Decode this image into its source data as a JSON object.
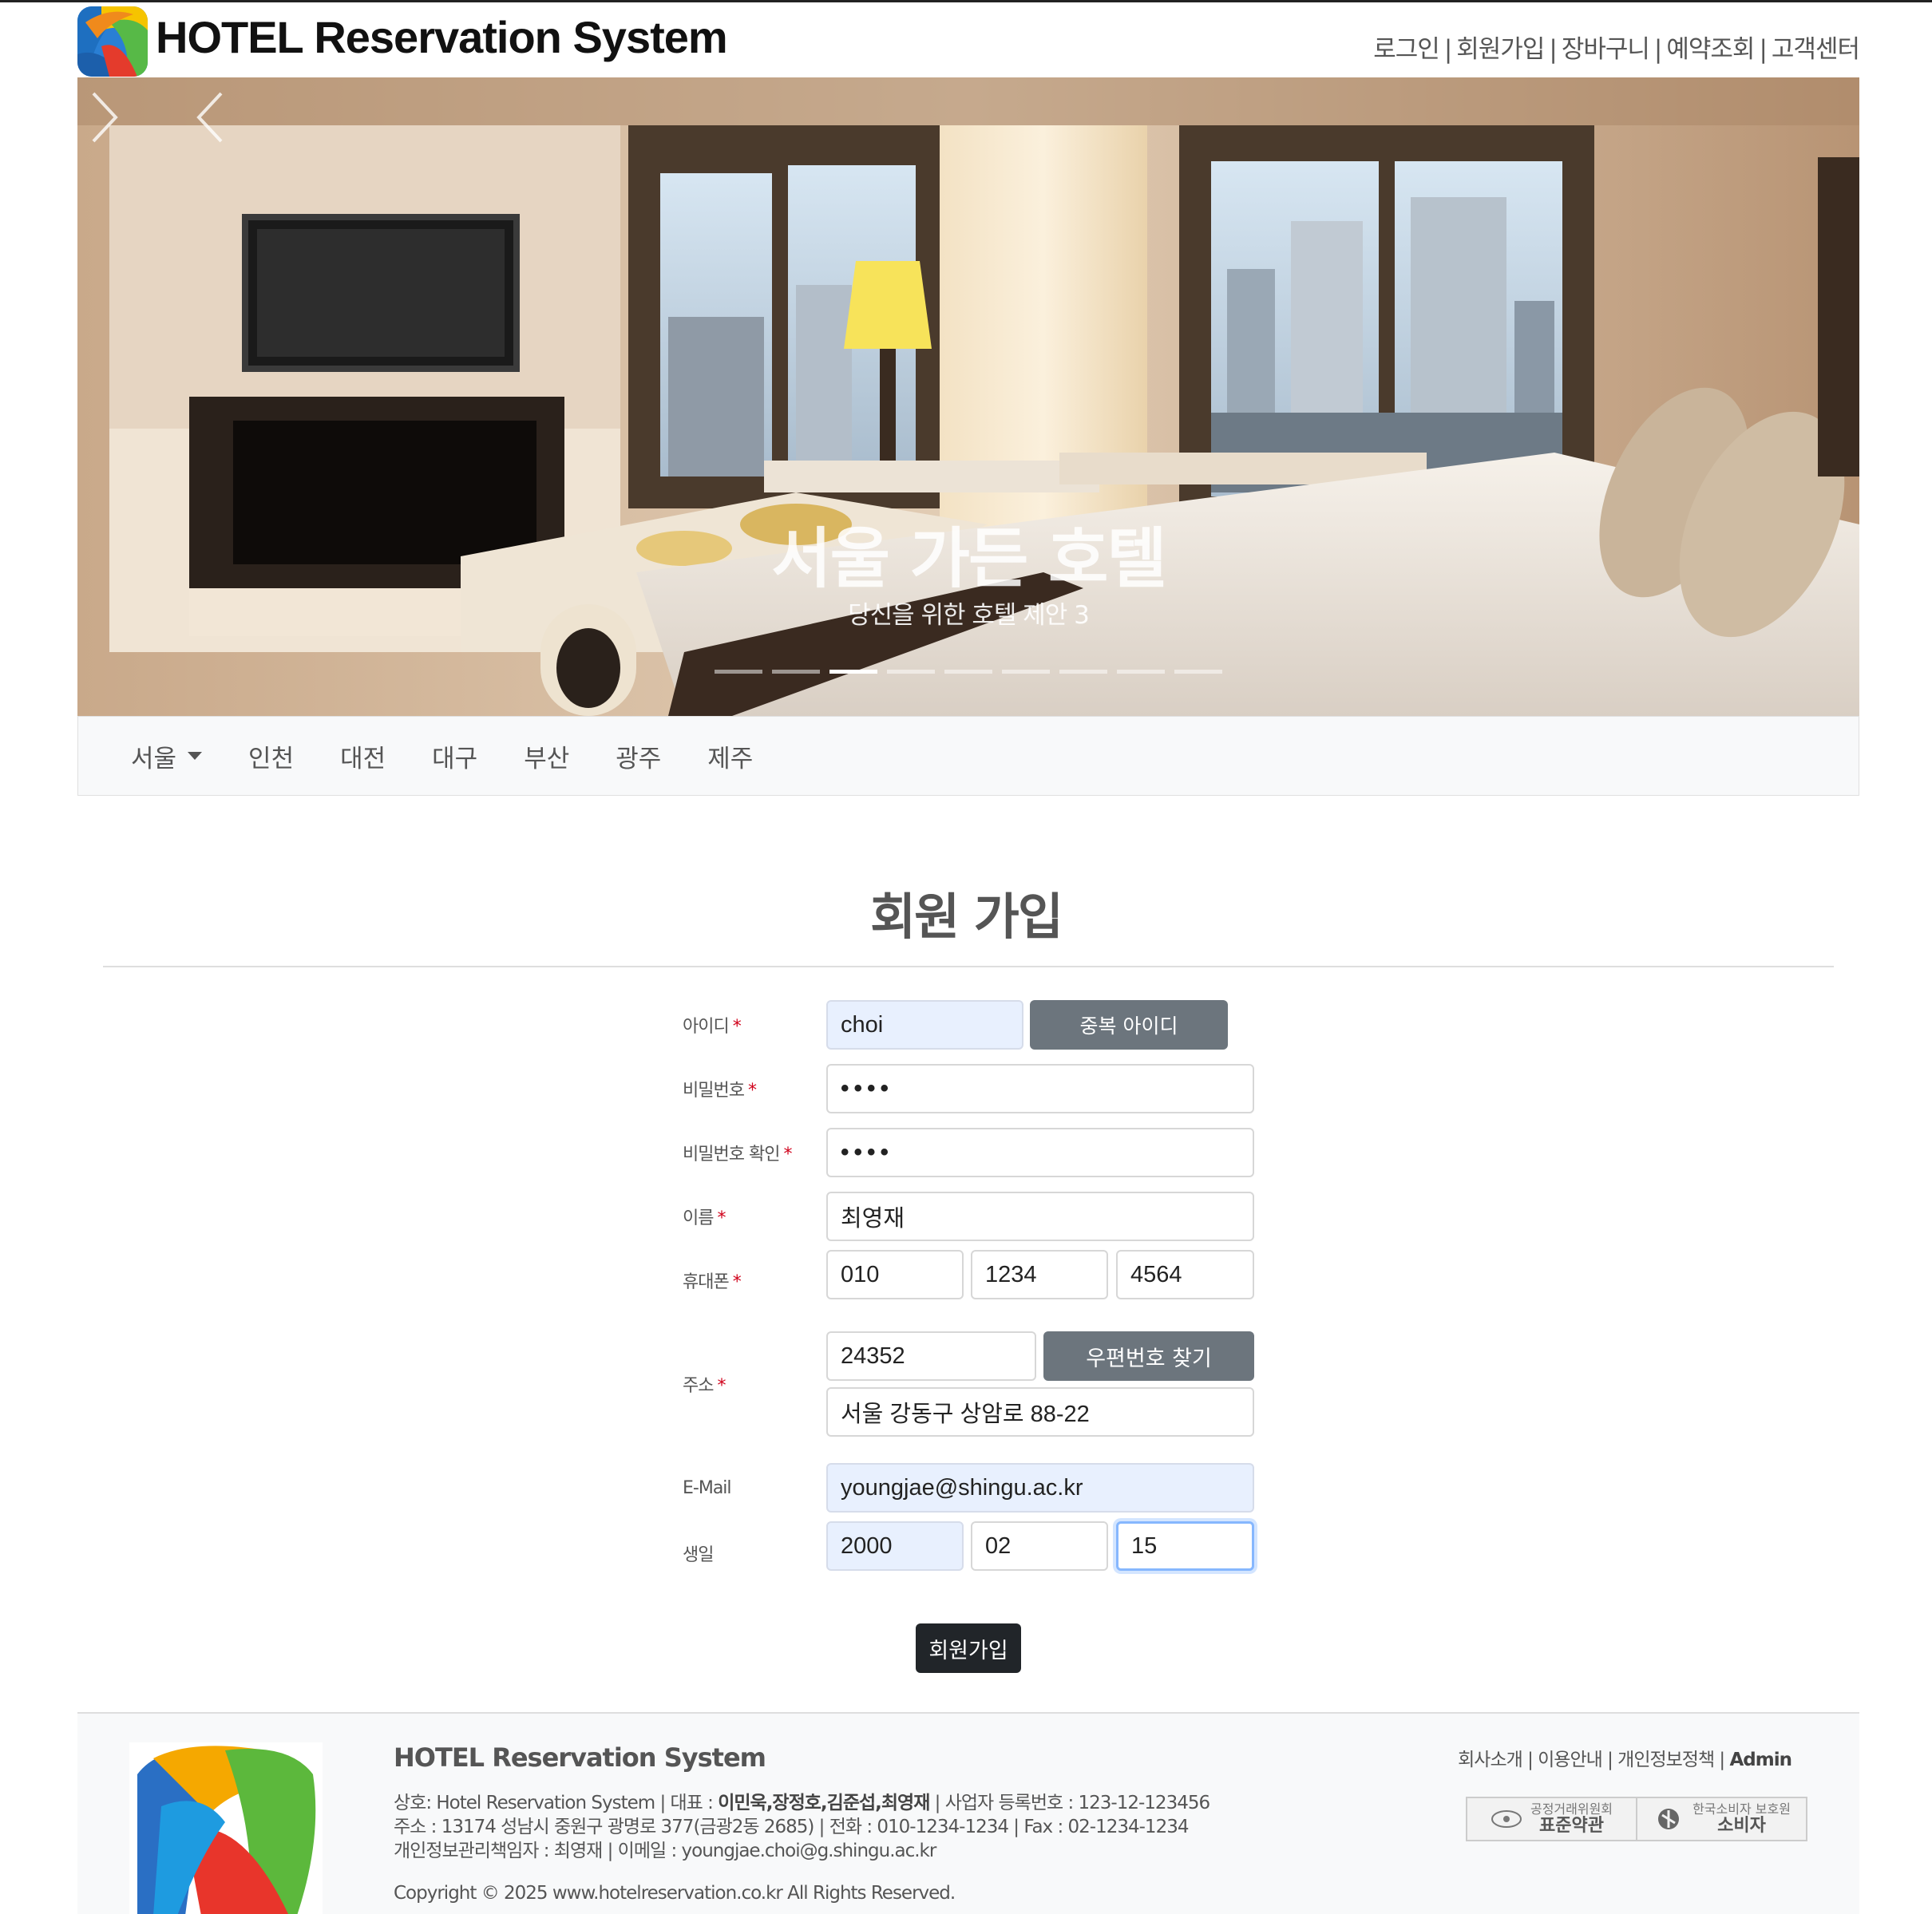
{
  "header": {
    "brand": "HOTEL Reservation System",
    "nav": [
      "로그인",
      "회원가입",
      "장바구니",
      "예약조회",
      "고객센터"
    ],
    "separator": "|"
  },
  "hero": {
    "title": "서울 가든 호텔",
    "subtitle": "당신을 위한 호텔 제안 3",
    "slide_count": 9,
    "active_slide": 3
  },
  "cities": [
    "서울",
    "인천",
    "대전",
    "대구",
    "부산",
    "광주",
    "제주"
  ],
  "page_title": "회원 가입",
  "form": {
    "id_label": "아이디",
    "id_value": "choi",
    "dup_button": "중복 아이디",
    "pw_label": "비밀번호",
    "pw_value": "••••",
    "pw_confirm_label": "비밀번호 확인",
    "pw_confirm_value": "••••",
    "name_label": "이름",
    "name_value": "최영재",
    "phone_label": "휴대폰",
    "phone": [
      "010",
      "1234",
      "4564"
    ],
    "addr_label": "주소",
    "zip_value": "24352",
    "zip_button": "우편번호 찾기",
    "addr_value": "서울 강동구 상암로 88-22",
    "email_label": "E-Mail",
    "email_value": "youngjae@shingu.ac.kr",
    "birth_label": "생일",
    "birth": [
      "2000",
      "02",
      "15"
    ],
    "required_mark": "*",
    "submit": "회원가입"
  },
  "footer": {
    "brand": "HOTEL Reservation System",
    "line1_a": "상호: Hotel Reservation System | 대표 : ",
    "line1_b": "이민욱,장정호,김준섭,최영재",
    "line1_c": " | 사업자 등록번호 : 123-12-123456",
    "line2": "주소 : 13174 성남시 중원구 광명로 377(금광2동 2685) | 전화 : 010-1234-1234 | Fax : 02-1234-1234",
    "line3": "개인정보관리책임자 : 최영재 | 이메일 : youngjae.choi@g.shingu.ac.kr",
    "copyright": "Copyright © 2025 www.hotelreservation.co.kr   All Rights Reserved.",
    "links": [
      "회사소개",
      "이용안내",
      "개인정보정책",
      "Admin"
    ],
    "badge1_top": "공정거래위원회",
    "badge1_bottom": "표준약관",
    "badge2_top": "한국소비자 보호원",
    "badge2_bottom": "소비자"
  },
  "colors": {
    "accent_button": "#6c757d",
    "submit_button": "#212529",
    "autofill": "#e8f0fe",
    "required": "#d0021b"
  }
}
